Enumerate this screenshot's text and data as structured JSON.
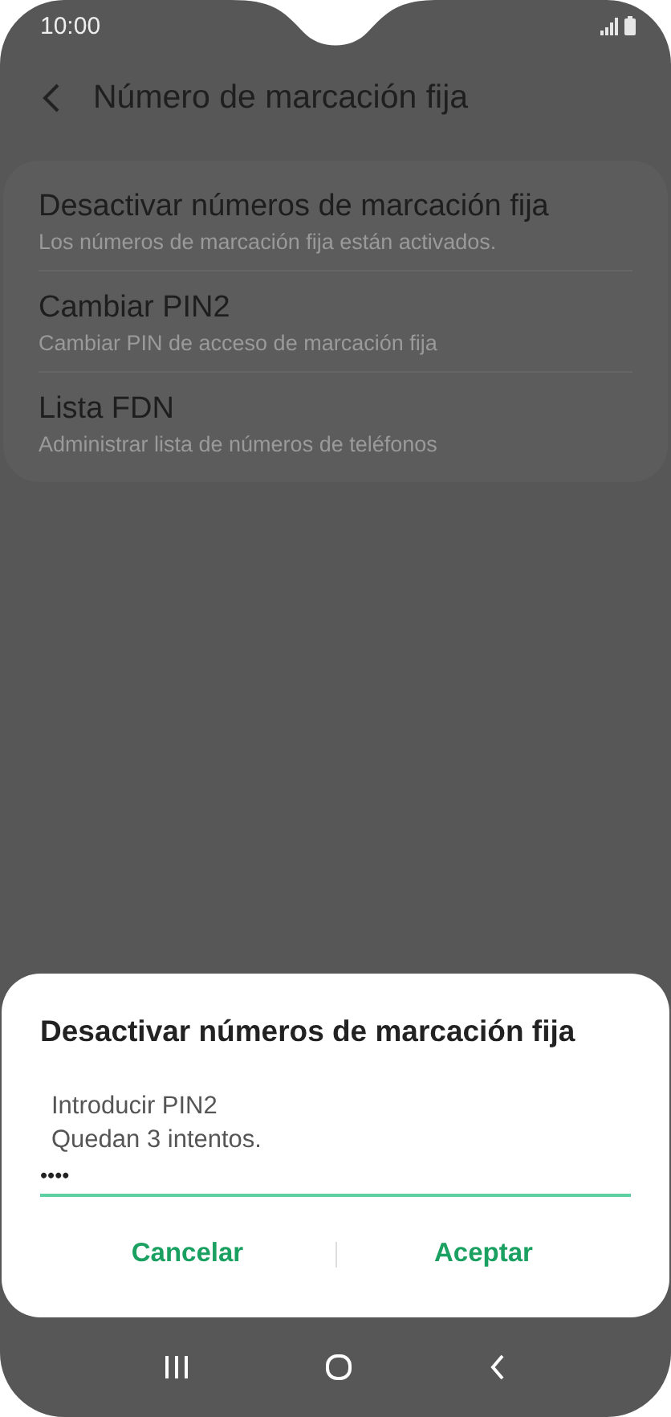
{
  "status_bar": {
    "time": "10:00"
  },
  "header": {
    "title": "Número de marcación fija"
  },
  "settings": [
    {
      "title": "Desactivar números de marcación fija",
      "subtitle": "Los números de marcación fija están activados."
    },
    {
      "title": "Cambiar PIN2",
      "subtitle": "Cambiar PIN de acceso de marcación fija"
    },
    {
      "title": "Lista FDN",
      "subtitle": "Administrar lista de números de teléfonos"
    }
  ],
  "dialog": {
    "title": "Desactivar números de marcación fija",
    "messages": [
      "Introducir PIN2",
      "Quedan 3 intentos."
    ],
    "pin_field": {
      "value": "••••"
    },
    "buttons": [
      "Cancelar",
      "Aceptar"
    ]
  }
}
